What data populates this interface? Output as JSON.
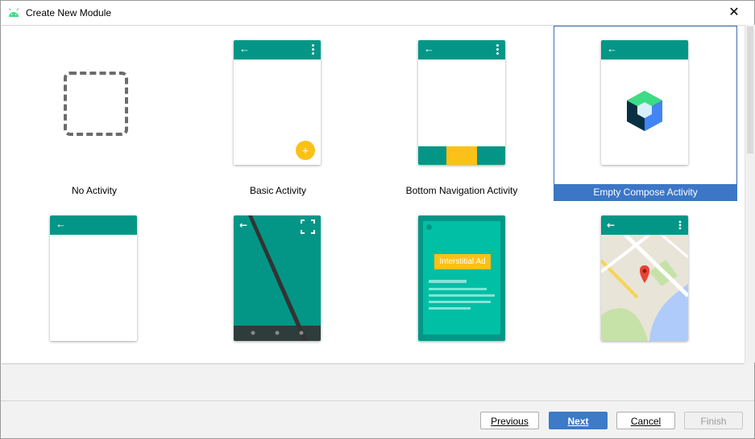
{
  "window": {
    "title": "Create New Module",
    "close_glyph": "✕"
  },
  "icons": {
    "app": "android-icon",
    "close": "close-icon"
  },
  "templates": [
    {
      "label": "No Activity"
    },
    {
      "label": "Basic Activity",
      "fab_glyph": "+"
    },
    {
      "label": "Bottom Navigation Activity"
    },
    {
      "label": "Empty Compose Activity",
      "selected": true
    },
    {
      "label": ""
    },
    {
      "label": ""
    },
    {
      "label": "",
      "ad_text": "Interstitial Ad"
    },
    {
      "label": ""
    }
  ],
  "colors": {
    "appbar": "#039687",
    "accent": "#fcc117",
    "selection": "#3c76c6"
  },
  "footer": {
    "previous": "Previous",
    "next": "Next",
    "cancel": "Cancel",
    "finish": "Finish"
  }
}
